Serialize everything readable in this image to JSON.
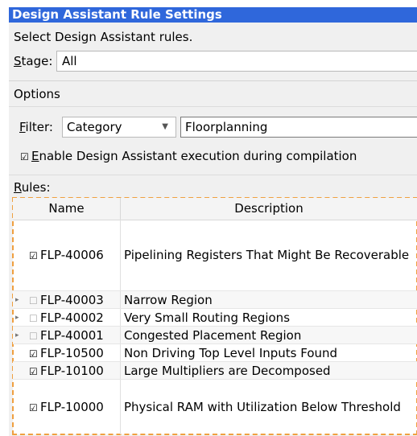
{
  "window": {
    "title": "Design Assistant Rule Settings"
  },
  "intro_text": "Select Design Assistant rules.",
  "stage": {
    "label": "Stage:",
    "value": "All"
  },
  "options": {
    "title": "Options",
    "filter_label": "Filter:",
    "filter_value": "Category",
    "filter_text": "Floorplanning",
    "enable_label": "Enable Design Assistant execution during compilation",
    "enable_checked": true
  },
  "rules": {
    "label": "Rules:",
    "columns": {
      "name": "Name",
      "description": "Description"
    },
    "items": [
      {
        "name": "FLP-40006",
        "description": "Pipelining Registers That Might Be Recoverable",
        "checked": true,
        "expandable": false
      },
      {
        "name": "FLP-40003",
        "description": "Narrow Region",
        "checked": false,
        "expandable": true
      },
      {
        "name": "FLP-40002",
        "description": "Very Small Routing Regions",
        "checked": false,
        "expandable": true
      },
      {
        "name": "FLP-40001",
        "description": "Congested Placement Region",
        "checked": false,
        "expandable": true
      },
      {
        "name": "FLP-10500",
        "description": "Non Driving Top Level Inputs Found",
        "checked": true,
        "expandable": false
      },
      {
        "name": "FLP-10100",
        "description": "Large Multipliers are Decomposed",
        "checked": true,
        "expandable": false
      },
      {
        "name": "FLP-10000",
        "description": "Physical RAM with Utilization Below Threshold",
        "checked": true,
        "expandable": false
      }
    ]
  }
}
